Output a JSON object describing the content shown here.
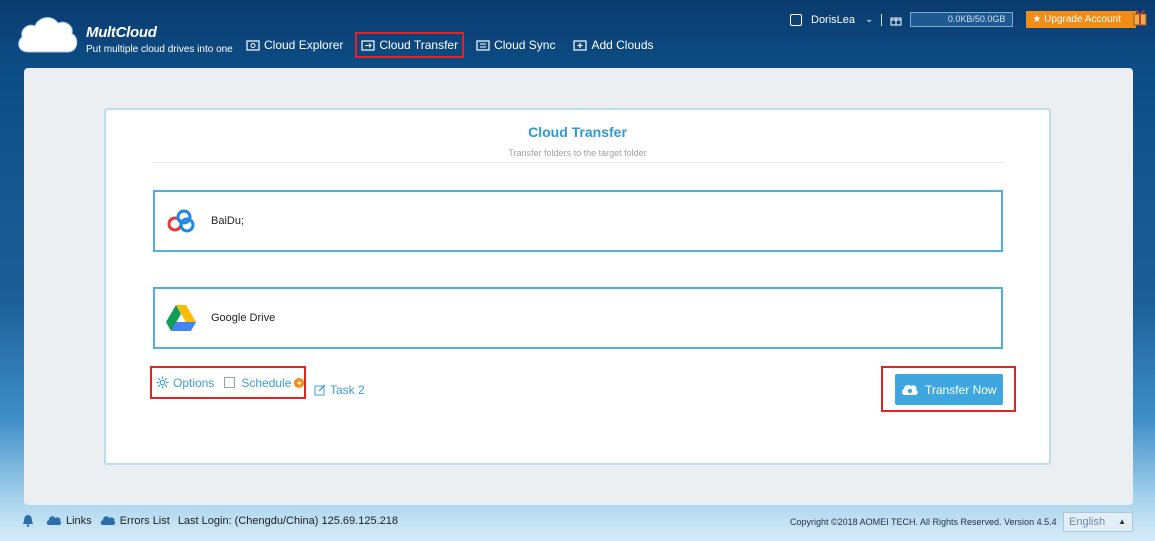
{
  "header": {
    "brand": "MultCloud",
    "tagline": "Put multiple cloud drives into one",
    "nav": [
      {
        "label": "Cloud Explorer",
        "icon": "cloud-explorer-icon"
      },
      {
        "label": "Cloud Transfer",
        "icon": "cloud-transfer-icon",
        "active": true
      },
      {
        "label": "Cloud Sync",
        "icon": "cloud-sync-icon"
      },
      {
        "label": "Add Clouds",
        "icon": "add-clouds-icon"
      }
    ],
    "user": "DorisLea",
    "quota": "0.0KB/50.0GB",
    "upgrade_label": "★ Upgrade Account"
  },
  "card": {
    "title": "Cloud Transfer",
    "subtitle": "Transfer folders to the target folder",
    "source": {
      "label": "BaiDu;",
      "icon": "baidu-icon"
    },
    "target": {
      "label": "Google Drive",
      "icon": "google-drive-icon"
    },
    "options_label": "Options",
    "schedule_label": "Schedule",
    "schedule_checked": false,
    "task_label": "Task 2",
    "transfer_label": "Transfer Now"
  },
  "footer": {
    "links_label": "Links",
    "errors_label": "Errors List",
    "last_login": "Last Login: (Chengdu/China) 125.69.125.218",
    "copyright": "Copyright ©2018 AOMEI TECH. All Rights Reserved. Version 4.5.4",
    "language": "English"
  },
  "colors": {
    "accent": "#3ea7df",
    "highlight": "#e32222",
    "upgrade": "#f28c14"
  }
}
